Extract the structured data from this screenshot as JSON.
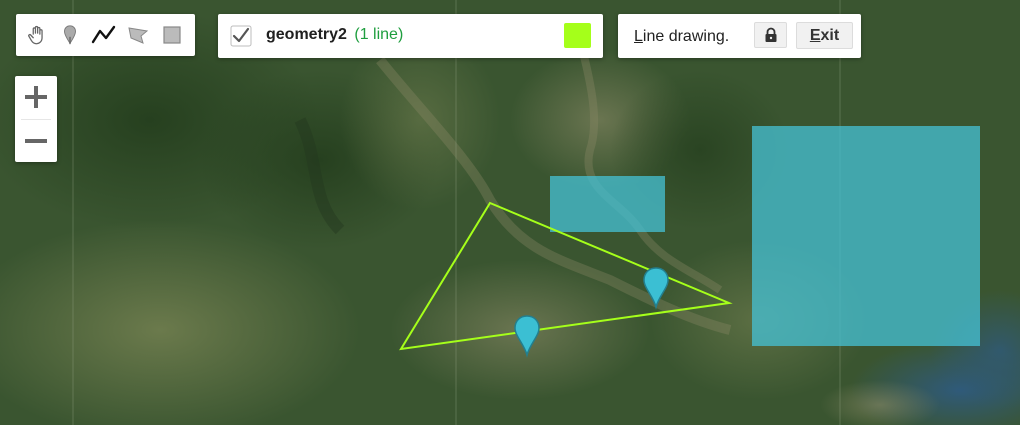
{
  "toolbar": {
    "tools": [
      {
        "name": "hand-tool",
        "icon": "hand-icon"
      },
      {
        "name": "marker-tool",
        "icon": "marker-icon"
      },
      {
        "name": "line-tool",
        "icon": "line-icon",
        "active": true
      },
      {
        "name": "polygon-tool",
        "icon": "polygon-icon"
      },
      {
        "name": "rectangle-tool",
        "icon": "rectangle-icon"
      }
    ]
  },
  "layer": {
    "name": "geometry2",
    "count": "(1 line)",
    "checked": true,
    "color": "#a5ff1a"
  },
  "mode": {
    "label_first": "L",
    "label_rest": "ine drawing.",
    "lock_icon": "lock-icon",
    "exit_first": "E",
    "exit_rest": "xit"
  },
  "zoom": {
    "in_icon": "plus-icon",
    "out_icon": "minus-icon"
  },
  "colors": {
    "line": "#a5ff1a",
    "rectangle_fill": "#46c2d6",
    "marker": "#3bbfd3"
  }
}
